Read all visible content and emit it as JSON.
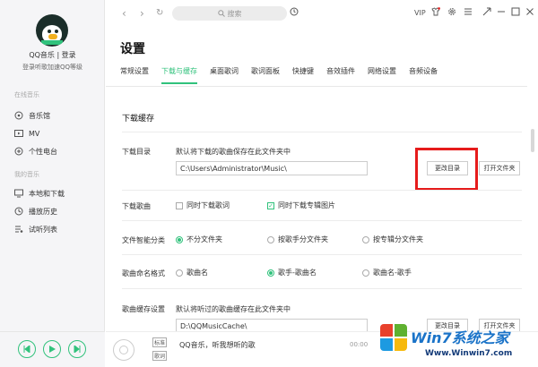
{
  "sidebar": {
    "user_name": "QQ音乐 | 登录",
    "user_sub": "登录听歌加速QQ等级",
    "section_online": "在线音乐",
    "online_items": [
      {
        "label": "音乐馆",
        "icon": "music-hall-icon"
      },
      {
        "label": "MV",
        "icon": "mv-icon"
      },
      {
        "label": "个性电台",
        "icon": "radio-icon"
      }
    ],
    "section_mine": "我的音乐",
    "mine_items": [
      {
        "label": "本地和下载",
        "icon": "computer-icon"
      },
      {
        "label": "播放历史",
        "icon": "history-icon"
      },
      {
        "label": "试听列表",
        "icon": "playlist-icon"
      }
    ]
  },
  "topbar": {
    "search_placeholder": "搜索",
    "vip": "VIP"
  },
  "settings": {
    "title": "设置",
    "tabs": [
      "常规设置",
      "下载与缓存",
      "桌面歌词",
      "歌词面板",
      "快捷键",
      "音效插件",
      "网络设置",
      "音频设备"
    ],
    "active_tab": "下载与缓存",
    "section_title": "下载缓存",
    "download_dir": {
      "label": "下载目录",
      "hint": "默认将下载的歌曲保存在此文件夹中",
      "path": "C:\\Users\\Administrator\\Music\\",
      "change_button": "更改目录",
      "open_button": "打开文件夹"
    },
    "download_song": {
      "label": "下载歌曲",
      "options": [
        {
          "label": "同时下载歌词",
          "checked": false
        },
        {
          "label": "同时下载专辑图片",
          "checked": true
        }
      ]
    },
    "smart_folder": {
      "label": "文件智能分类",
      "options": [
        {
          "label": "不分文件夹",
          "selected": true
        },
        {
          "label": "按歌手分文件夹",
          "selected": false
        },
        {
          "label": "按专辑分文件夹",
          "selected": false
        }
      ]
    },
    "naming": {
      "label": "歌曲命名格式",
      "options": [
        {
          "label": "歌曲名",
          "selected": false
        },
        {
          "label": "歌手-歌曲名",
          "selected": true
        },
        {
          "label": "歌曲名-歌手",
          "selected": false
        }
      ]
    },
    "cache": {
      "label": "歌曲缓存设置",
      "hint": "默认将听过的歌曲缓存在此文件夹中",
      "path": "D:\\QQMusicCache\\",
      "change_button": "更改目录",
      "open_button": "打开文件夹"
    }
  },
  "player": {
    "tag_top": "标准",
    "tag_bottom": "歌词",
    "song": "QQ音乐，听我想听的歌",
    "elapsed": "00:00"
  },
  "watermark": {
    "brand": "Win7系统之家",
    "url": "Www.Winwin7.com"
  },
  "colors": {
    "accent": "#31c27c",
    "highlight_box": "#e61b1b"
  }
}
